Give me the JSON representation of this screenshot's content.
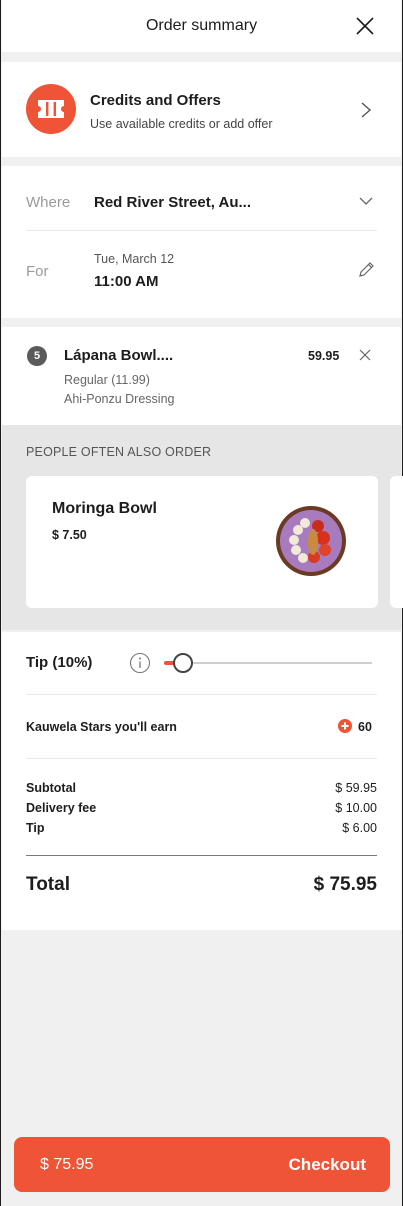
{
  "header": {
    "title": "Order summary"
  },
  "credits": {
    "title": "Credits and Offers",
    "subtitle": "Use available credits or add offer"
  },
  "details": {
    "where_label": "Where",
    "where_value": "Red River Street, Au...",
    "for_label": "For",
    "for_date": "Tue, March 12",
    "for_time": "11:00 AM"
  },
  "cart_item": {
    "quantity": "5",
    "name": "Lápana Bowl....",
    "price": "59.95",
    "size": "Regular (11.99)",
    "dressing": "Ahi-Ponzu Dressing"
  },
  "upsell": {
    "title": "PEOPLE OFTEN ALSO ORDER",
    "items": [
      {
        "name": "Moringa Bowl",
        "price": "$ 7.50"
      }
    ]
  },
  "summary": {
    "tip_label": "Tip (10%)",
    "tip_slider_fraction": 0.09,
    "stars_label": "Kauwela Stars you'll earn",
    "stars_value": "60",
    "subtotal_label": "Subtotal",
    "subtotal_value": "$ 59.95",
    "delivery_label": "Delivery fee",
    "delivery_value": "$ 10.00",
    "tip_row_label": "Tip",
    "tip_row_value": "$ 6.00",
    "total_label": "Total",
    "total_value": "$ 75.95"
  },
  "checkout": {
    "price": "$ 75.95",
    "label": "Checkout"
  },
  "colors": {
    "accent": "#ef5436",
    "panel_gray": "#e6e6e6",
    "page_gray": "#f0f0f0"
  }
}
